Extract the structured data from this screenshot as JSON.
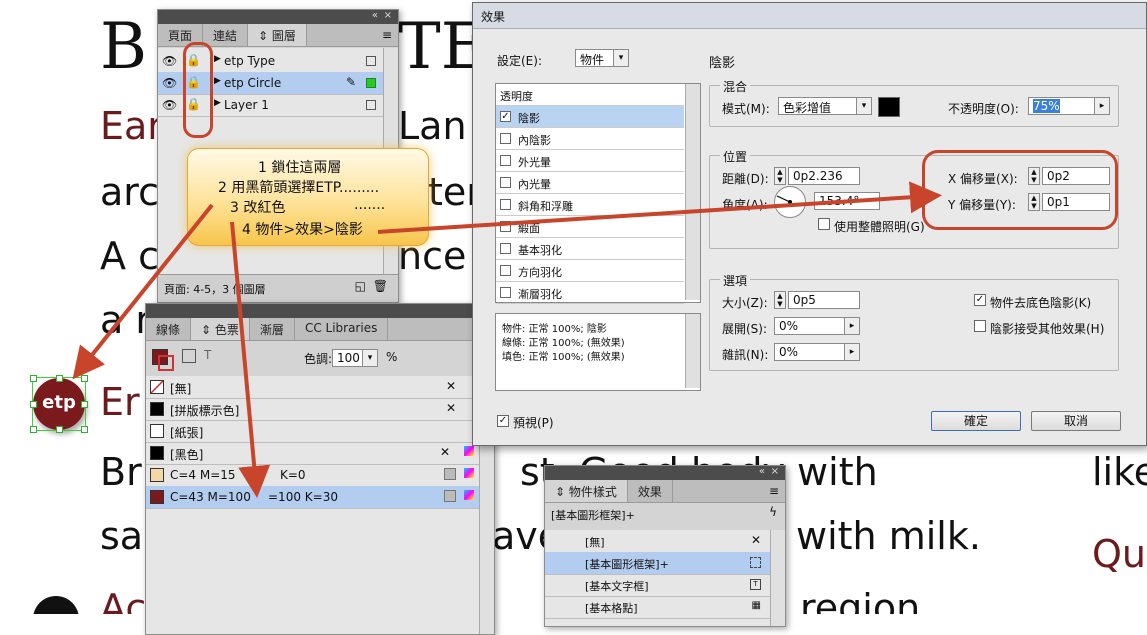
{
  "document": {
    "heading_left": "B",
    "heading_right": "TE",
    "lines": [
      {
        "a": "Ear",
        "b": "Lan"
      },
      {
        "a": "arc",
        "b": "ter"
      },
      {
        "a": "A c",
        "b": "nce"
      },
      {
        "a": "a r",
        "b": ""
      },
      {
        "a": "Er",
        "b": ""
      },
      {
        "a": "Br",
        "b": "st. Good body with"
      },
      {
        "a": "sa",
        "b": "ave",
        "c": "with milk."
      },
      {
        "a": "Ac",
        "b": "region"
      }
    ],
    "right_words": [
      "like",
      "Qu"
    ],
    "logo_text": "etp"
  },
  "layers_panel": {
    "tabs": [
      "頁面",
      "連結",
      "圖層"
    ],
    "active_tab": "圖層",
    "layers": [
      {
        "name": "etp Type",
        "locked": true,
        "selected": false
      },
      {
        "name": "etp Circle",
        "locked": true,
        "selected": true
      },
      {
        "name": "Layer 1",
        "locked": true,
        "selected": false
      }
    ],
    "footer_text": "頁面: 4-5，3 個圖層"
  },
  "swatches_panel": {
    "tabs": [
      "線條",
      "色票",
      "漸層",
      "CC Libraries"
    ],
    "active_tab": "色票",
    "tint_label": "色調:",
    "tint_value": "100",
    "tint_unit": "%",
    "swatches": [
      {
        "name": "[無]",
        "color": "none",
        "selected": false
      },
      {
        "name": "[拼版標示色]",
        "color": "#000000",
        "selected": false
      },
      {
        "name": "[紙張]",
        "color": "#ffffff",
        "selected": false
      },
      {
        "name": "[黑色]",
        "color": "#000000",
        "selected": false
      },
      {
        "name": "C=4 M=15 Y=... K=0",
        "color": "#f2d9a6",
        "selected": false
      },
      {
        "name": "C=43 M=100 Y=100 K=30",
        "color": "#7a1a1c",
        "selected": true
      }
    ],
    "swatch_display_names": [
      "[無]",
      "[拼版標示色]",
      "[紙張]",
      "[黑色]",
      "C=4 M=15",
      "K=0",
      "C=43 M=100",
      "=100 K=30"
    ]
  },
  "object_styles_panel": {
    "tabs": [
      "物件樣式",
      "效果"
    ],
    "active_tab": "物件樣式",
    "current": "[基本圖形框架]+",
    "items": [
      {
        "name": "[無]",
        "selected": false
      },
      {
        "name": "[基本圖形框架]+",
        "selected": true
      },
      {
        "name": "[基本文字框]",
        "selected": false
      },
      {
        "name": "[基本格點]",
        "selected": false
      }
    ]
  },
  "effects_dialog": {
    "title": "效果",
    "settings_label": "設定(E):",
    "settings_value": "物件",
    "effects_list": [
      {
        "name": "透明度",
        "checkbox": false,
        "checked": false,
        "selected": false
      },
      {
        "name": "陰影",
        "checkbox": true,
        "checked": true,
        "selected": true
      },
      {
        "name": "內陰影",
        "checkbox": true,
        "checked": false,
        "selected": false
      },
      {
        "name": "外光暈",
        "checkbox": true,
        "checked": false,
        "selected": false
      },
      {
        "name": "內光暈",
        "checkbox": true,
        "checked": false,
        "selected": false
      },
      {
        "name": "斜角和浮雕",
        "checkbox": true,
        "checked": false,
        "selected": false
      },
      {
        "name": "緞面",
        "checkbox": true,
        "checked": false,
        "selected": false
      },
      {
        "name": "基本羽化",
        "checkbox": true,
        "checked": false,
        "selected": false
      },
      {
        "name": "方向羽化",
        "checkbox": true,
        "checked": false,
        "selected": false
      },
      {
        "name": "漸層羽化",
        "checkbox": true,
        "checked": false,
        "selected": false
      }
    ],
    "summary": [
      "物件: 正常 100%; 陰影",
      "線條: 正常 100%; (無效果)",
      "填色: 正常 100%; (無效果)"
    ],
    "section_title": "陰影",
    "blend_group": "混合",
    "mode_label": "模式(M):",
    "mode_value": "色彩增值",
    "opacity_label": "不透明度(O):",
    "opacity_value": "75%",
    "position_group": "位置",
    "distance_label": "距離(D):",
    "distance_value": "0p2.236",
    "angle_label": "角度(A):",
    "angle_value": "153.4°",
    "global_light_label": "使用整體照明(G)",
    "x_offset_label": "X 偏移量(X):",
    "x_offset_value": "0p2",
    "y_offset_label": "Y 偏移量(Y):",
    "y_offset_value": "0p1",
    "options_group": "選項",
    "size_label": "大小(Z):",
    "size_value": "0p5",
    "spread_label": "展開(S):",
    "spread_value": "0%",
    "noise_label": "雜訊(N):",
    "noise_value": "0%",
    "knockout_label": "物件去底色陰影(K)",
    "knockout_checked": true,
    "honor_label": "陰影接受其他效果(H)",
    "honor_checked": false,
    "preview_label": "預視(P)",
    "preview_checked": true,
    "ok_label": "確定",
    "cancel_label": "取消"
  },
  "callout": {
    "lines": [
      "1 鎖住這兩層",
      "2 用黑箭頭選擇ETP.........",
      "3 改紅色",
      ".......",
      "4 物件>效果>陰影"
    ]
  },
  "colors": {
    "annotation_red": "#c8452c",
    "brand_maroon": "#7a1a1c",
    "selection_blue": "#b3cdf0",
    "opacity_highlight": "#3a7fd8"
  }
}
